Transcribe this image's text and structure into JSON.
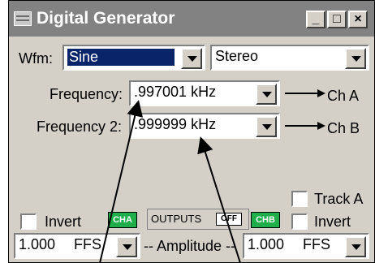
{
  "window": {
    "title": "Digital Generator",
    "controls": {
      "minimize": "_",
      "maximize": "□",
      "close": "×"
    }
  },
  "waveform": {
    "label": "Wfm:",
    "value": "Sine"
  },
  "channel_mode": {
    "value": "Stereo"
  },
  "frequency": {
    "label": "Frequency:",
    "value": ".997001 kHz",
    "target": "Ch A"
  },
  "frequency2": {
    "label": "Frequency 2:",
    "value": ".999999 kHz",
    "target": "Ch B"
  },
  "track_a": {
    "label": "Track A"
  },
  "invert_left": {
    "label": "Invert"
  },
  "invert_right": {
    "label": "Invert"
  },
  "outputs": {
    "label": "OUTPUTS",
    "button": "OFF"
  },
  "badges": {
    "cha": "CHA",
    "chb": "CHB"
  },
  "amplitude": {
    "label": "-- Amplitude --",
    "left_value": "1.000",
    "left_unit": "FFS",
    "right_value": "1.000",
    "right_unit": "FFS"
  },
  "colors": {
    "title_bar": "#828282",
    "badge": "#1fae4a",
    "selection": "#0a246a"
  }
}
